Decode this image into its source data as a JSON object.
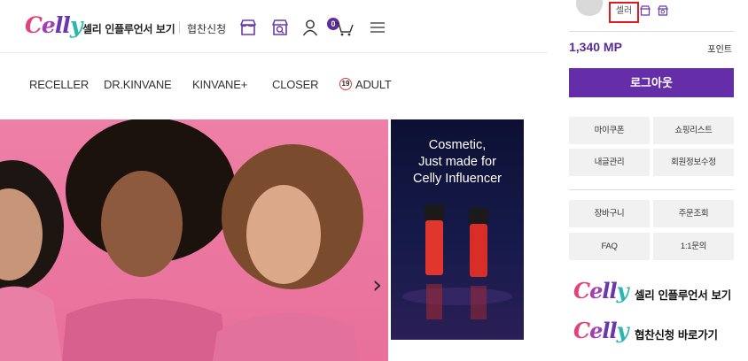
{
  "header": {
    "logo": {
      "part1": "C",
      "part2": "e",
      "part3": "ll",
      "part4": "y"
    },
    "influencer_link": "셀리 인플루언서 보기",
    "sponsor_link": "협찬신청",
    "cart_count": "0",
    "icons": [
      "store-icon",
      "store-search-icon",
      "user-icon",
      "cart-icon",
      "menu-icon"
    ]
  },
  "nav": {
    "items": [
      "RECELLER",
      "DR.KINVANE",
      "KINVANE+",
      "CLOSER",
      "ADULT"
    ],
    "adult_badge": "19"
  },
  "banners": {
    "side_title_lines": [
      "Cosmetic,",
      "Just made for",
      "Celly Influencer"
    ],
    "carousel_arrow": "›"
  },
  "drawer": {
    "user_name": "셀러",
    "points": "1,340 MP",
    "points_label": "포인트",
    "logout_label": "로그아웃",
    "group1": [
      "마이쿠폰",
      "쇼핑리스트",
      "내글관리",
      "회원정보수정"
    ],
    "group2": [
      "장바구니",
      "주문조회",
      "FAQ",
      "1:1문의"
    ],
    "promo1": "셀리 인플루언서 보기",
    "promo2": "협찬신청 바로가기",
    "promo_logo": {
      "part1": "C",
      "part2": "e",
      "part3": "ll",
      "part4": "y"
    }
  },
  "colors": {
    "brand_purple": "#652da8",
    "logo_pink": "#e2417e",
    "logo_teal": "#2bb7b0",
    "highlight_red": "#e21b1b"
  }
}
